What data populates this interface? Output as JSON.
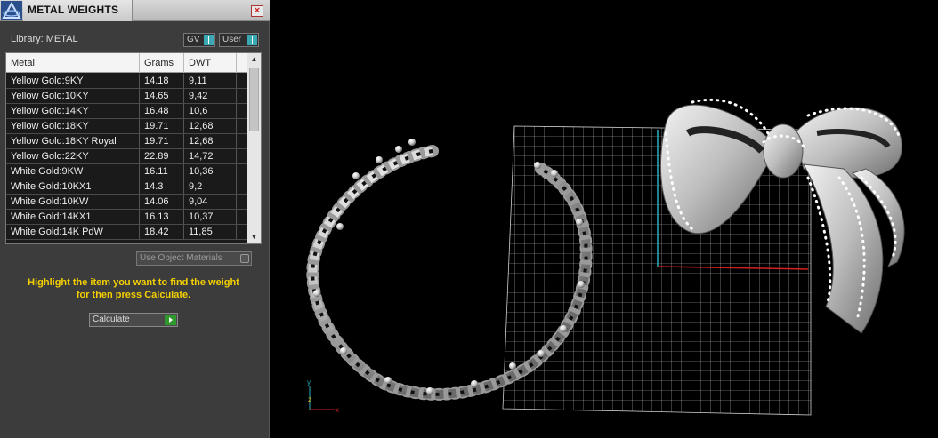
{
  "panel": {
    "title": "METAL WEIGHTS",
    "close_symbol": "×",
    "library_label": "Library: METAL",
    "toggle_gv": "GV",
    "toggle_user": "User"
  },
  "table": {
    "headers": {
      "metal": "Metal",
      "grams": "Grams",
      "dwt": "DWT"
    },
    "rows": [
      {
        "metal": "Yellow Gold:9KY",
        "grams": "14.18",
        "dwt": "9,11"
      },
      {
        "metal": "Yellow Gold:10KY",
        "grams": "14.65",
        "dwt": "9,42"
      },
      {
        "metal": "Yellow Gold:14KY",
        "grams": "16.48",
        "dwt": "10,6"
      },
      {
        "metal": "Yellow Gold:18KY",
        "grams": "19.71",
        "dwt": "12,68"
      },
      {
        "metal": "Yellow Gold:18KY Royal",
        "grams": "19.71",
        "dwt": "12,68"
      },
      {
        "metal": "Yellow Gold:22KY",
        "grams": "22.89",
        "dwt": "14,72"
      },
      {
        "metal": "White Gold:9KW",
        "grams": "16.11",
        "dwt": "10,36"
      },
      {
        "metal": "White Gold:10KX1",
        "grams": "14.3",
        "dwt": "9,2"
      },
      {
        "metal": "White Gold:10KW",
        "grams": "14.06",
        "dwt": "9,04"
      },
      {
        "metal": "White Gold:14KX1",
        "grams": "16.13",
        "dwt": "10,37"
      },
      {
        "metal": "White Gold:14K PdW",
        "grams": "18.42",
        "dwt": "11,85"
      }
    ]
  },
  "use_object_materials": "Use Object Materials",
  "hint_line1": "Highlight the item you want to find the weight",
  "hint_line2": "for then press Calculate.",
  "calculate_label": "Calculate",
  "colors": {
    "panel_bg": "#3c3c3c",
    "hint": "#f4d000",
    "accent_teal": "#3aa9b3",
    "go_green": "#2e9a2e",
    "axis_red": "#d02020",
    "axis_cyan": "#2ab0c0"
  }
}
